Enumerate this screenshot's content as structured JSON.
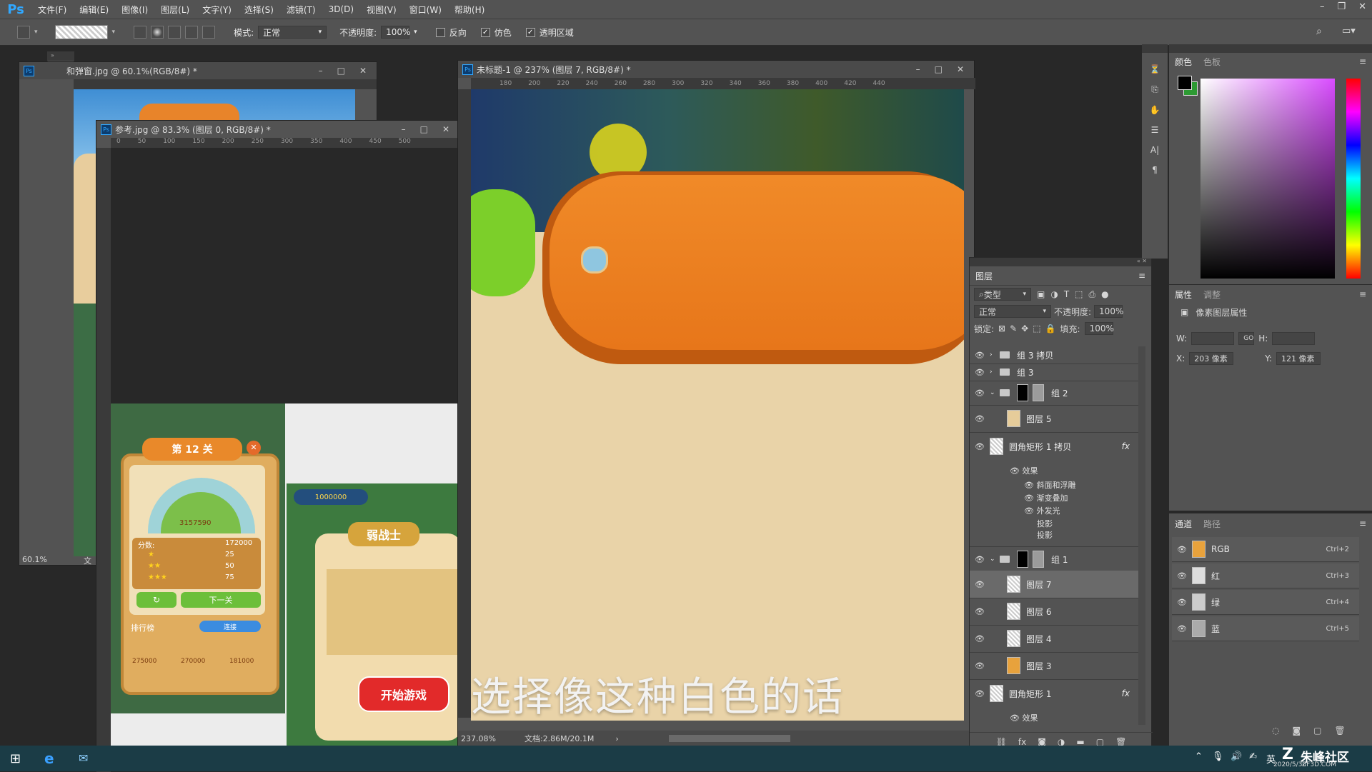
{
  "app": {
    "logo": "Ps"
  },
  "menu": [
    "文件(F)",
    "编辑(E)",
    "图像(I)",
    "图层(L)",
    "文字(Y)",
    "选择(S)",
    "滤镜(T)",
    "3D(D)",
    "视图(V)",
    "窗口(W)",
    "帮助(H)"
  ],
  "options": {
    "mode_label": "模式:",
    "mode_value": "正常",
    "opacity_label": "不透明度:",
    "opacity_value": "100%",
    "reverse_label": "反向",
    "dither_label": "仿色",
    "transparency_label": "透明区域"
  },
  "docs": {
    "back": {
      "title": "和弹窗.jpg @ 60.1%(RGB/8#) *",
      "zoom": "60.1%",
      "doc": "文"
    },
    "ref": {
      "title": "参考.jpg @ 83.3% (图层 0, RGB/8#) *",
      "ruler": [
        "0",
        "50",
        "100",
        "150",
        "200",
        "250",
        "300",
        "350",
        "400",
        "450",
        "500"
      ],
      "game": {
        "level": "第 12 关",
        "score_num": "3157590",
        "score_label": "分数:",
        "score_value": "172000",
        "s1": "25",
        "s2": "50",
        "s3": "75",
        "next": "下一关",
        "rank": "排行榜",
        "connect": "连接",
        "r1": "275000",
        "r2": "270000",
        "r3": "181000",
        "coins": "1000000",
        "warrior": "弱战士",
        "start": "开始游戏"
      }
    },
    "main": {
      "title": "未标题-1 @ 237% (图层 7, RGB/8#) *",
      "ruler": [
        "180",
        "200",
        "220",
        "240",
        "260",
        "280",
        "300",
        "320",
        "340",
        "360",
        "380",
        "400",
        "420",
        "440"
      ],
      "zoom": "237.08%",
      "doc": "文档:2.86M/20.1M",
      "subtitle": "选择像这种白色的话"
    }
  },
  "layers": {
    "tab": "图层",
    "filter": "类型",
    "blend": "正常",
    "opacity_label": "不透明度:",
    "opacity_value": "100%",
    "lock_label": "锁定:",
    "fill_label": "填充:",
    "fill_value": "100%",
    "items": [
      {
        "name": "组 3 拷贝",
        "kind": "group"
      },
      {
        "name": "组 3",
        "kind": "group"
      },
      {
        "name": "组 2",
        "kind": "group-mask"
      },
      {
        "name": "图层 5",
        "kind": "layer"
      },
      {
        "name": "圆角矩形 1 拷贝",
        "kind": "shape",
        "fx": "fx"
      },
      {
        "name": "组 1",
        "kind": "group-mask"
      },
      {
        "name": "图层 7",
        "kind": "layer",
        "selected": true
      },
      {
        "name": "图层 6",
        "kind": "layer"
      },
      {
        "name": "图层 4",
        "kind": "layer"
      },
      {
        "name": "图层 3",
        "kind": "layer"
      },
      {
        "name": "圆角矩形 1",
        "kind": "shape",
        "fx": "fx"
      }
    ],
    "effects": {
      "label": "效果",
      "bevel": "斜面和浮雕",
      "gradient": "渐变叠加",
      "glow": "外发光",
      "shadow1": "投影",
      "shadow2": "投影",
      "label2": "效果"
    }
  },
  "color_panel": {
    "tab1": "颜色",
    "tab2": "色板"
  },
  "props": {
    "tab1": "属性",
    "tab2": "调整",
    "type": "像素图层属性",
    "w": "W:",
    "h": "H:",
    "x_label": "X:",
    "x_value": "203 像素",
    "y_label": "Y:",
    "y_value": "121 像素",
    "link": "GO"
  },
  "channels": {
    "tab1": "通道",
    "tab2": "路径",
    "items": [
      {
        "name": "RGB",
        "shortcut": "Ctrl+2"
      },
      {
        "name": "红",
        "shortcut": "Ctrl+3"
      },
      {
        "name": "绿",
        "shortcut": "Ctrl+4"
      },
      {
        "name": "蓝",
        "shortcut": "Ctrl+5"
      }
    ]
  },
  "taskbar": {
    "ime": "英",
    "watermark": "朱峰社区",
    "url": "ZF3D.COM",
    "date": "2020/5/30"
  }
}
